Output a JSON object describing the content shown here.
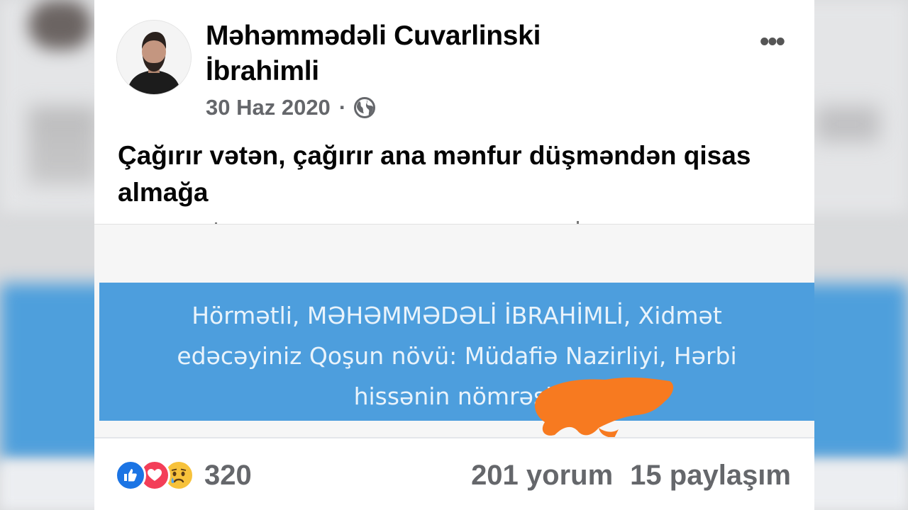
{
  "post": {
    "author_line1": "Məhəmmədəli Cuvarlinski",
    "author_line2": "İbrahimli",
    "date": "30 Haz 2020",
    "separator": "·",
    "privacy_icon": "globe-icon",
    "more_icon": "more-options-icon",
    "more_glyph": "•••",
    "text": "Çağırır vətən, çağırır ana mənfur düşməndən qisas almağa"
  },
  "shared_image": {
    "line1": "Hörmətli, MƏHƏMMƏDƏLİ İBRAHİMLİ, Xidmət",
    "line2": "edəcəyiniz Qoşun növü: Müdafiə Nazirliyi, Hərbi",
    "line3": "hissənin nömrəsi: ",
    "redaction_color": "#f77a20",
    "box_color": "#4d9edd"
  },
  "footer": {
    "reaction_icons": [
      "like-icon",
      "love-icon",
      "sad-icon"
    ],
    "reaction_count": "320",
    "comments": "201 yorum",
    "shares": "15 paylaşım"
  },
  "colors": {
    "primary_text": "#050505",
    "secondary_text": "#65676b",
    "like_blue": "#1b74e4",
    "love_red": "#f33e58",
    "sad_yellow": "#f7c23b"
  }
}
